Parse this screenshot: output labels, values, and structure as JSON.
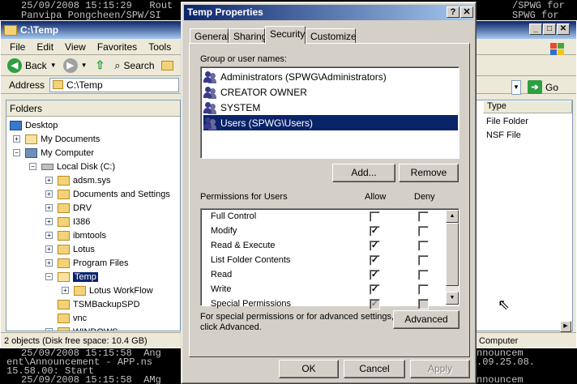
{
  "console": {
    "top_lines": [
      "25/09/2008 15:15:29   Rout",
      "Panvipa Pongcheen/SPW/SI"
    ],
    "right_top_lines": [
      "/SPWG for",
      "SPWG for"
    ],
    "bottom_lines": [
      "25/09/2008 15:15:58  Ang",
      "ent\\Announcement - APP.ns",
      "15.58.00: Start",
      "25/09/2008 15:15:58  AMg"
    ],
    "right_bottom_lines": [
      "nnouncem",
      ".09.25.08.",
      "nnouncem"
    ]
  },
  "explorer": {
    "title": "C:\\Temp",
    "menu": [
      "File",
      "Edit",
      "View",
      "Favorites",
      "Tools"
    ],
    "back_label": "Back",
    "search_label": "Search",
    "address_label": "Address",
    "address_value": "C:\\Temp",
    "go_label": "Go",
    "folders_header": "Folders",
    "tree": [
      {
        "label": "Desktop",
        "level": 0,
        "expander": ""
      },
      {
        "label": "My Documents",
        "level": 1,
        "expander": "+"
      },
      {
        "label": "My Computer",
        "level": 1,
        "expander": "−"
      },
      {
        "label": "Local Disk (C:)",
        "level": 2,
        "expander": "−"
      },
      {
        "label": "adsm.sys",
        "level": 3,
        "expander": "+"
      },
      {
        "label": "Documents and Settings",
        "level": 3,
        "expander": "+"
      },
      {
        "label": "DRV",
        "level": 3,
        "expander": "+"
      },
      {
        "label": "I386",
        "level": 3,
        "expander": "+"
      },
      {
        "label": "ibmtools",
        "level": 3,
        "expander": "+"
      },
      {
        "label": "Lotus",
        "level": 3,
        "expander": "+"
      },
      {
        "label": "Program Files",
        "level": 3,
        "expander": "+"
      },
      {
        "label": "Temp",
        "level": 3,
        "expander": "−"
      },
      {
        "label": "Lotus WorkFlow",
        "level": 4,
        "expander": "+"
      },
      {
        "label": "TSMBackupSPD",
        "level": 3,
        "expander": ""
      },
      {
        "label": "vnc",
        "level": 3,
        "expander": ""
      },
      {
        "label": "WINDOWS",
        "level": 3,
        "expander": "+"
      }
    ],
    "type_header": "Type",
    "file_types": [
      "File Folder",
      "NSF File"
    ],
    "status_text": "2 objects (Disk free space: 10.4 GB)",
    "status_right": "Computer"
  },
  "dialog": {
    "title": "Temp Properties",
    "help_label": "?",
    "close_label": "✕",
    "tabs": [
      "General",
      "Sharing",
      "Security",
      "Customize"
    ],
    "active_tab": "Security",
    "group_label": "Group or user names:",
    "groups": [
      "Administrators (SPWG\\Administrators)",
      "CREATOR OWNER",
      "SYSTEM",
      "Users (SPWG\\Users)"
    ],
    "selected_group": 3,
    "add_label": "Add...",
    "remove_label": "Remove",
    "permissions_label": "Permissions for Users",
    "allow_label": "Allow",
    "deny_label": "Deny",
    "permissions": [
      {
        "name": "Full Control",
        "allow": false,
        "deny": false
      },
      {
        "name": "Modify",
        "allow": true,
        "deny": false
      },
      {
        "name": "Read & Execute",
        "allow": true,
        "deny": false
      },
      {
        "name": "List Folder Contents",
        "allow": true,
        "deny": false
      },
      {
        "name": "Read",
        "allow": true,
        "deny": false
      },
      {
        "name": "Write",
        "allow": true,
        "deny": false
      },
      {
        "name": "Special Permissions",
        "allow": true,
        "deny": false
      }
    ],
    "special_text_1": "For special permissions or for advanced settings,",
    "special_text_2": "click Advanced.",
    "advanced_label": "Advanced",
    "ok_label": "OK",
    "cancel_label": "Cancel",
    "apply_label": "Apply"
  }
}
